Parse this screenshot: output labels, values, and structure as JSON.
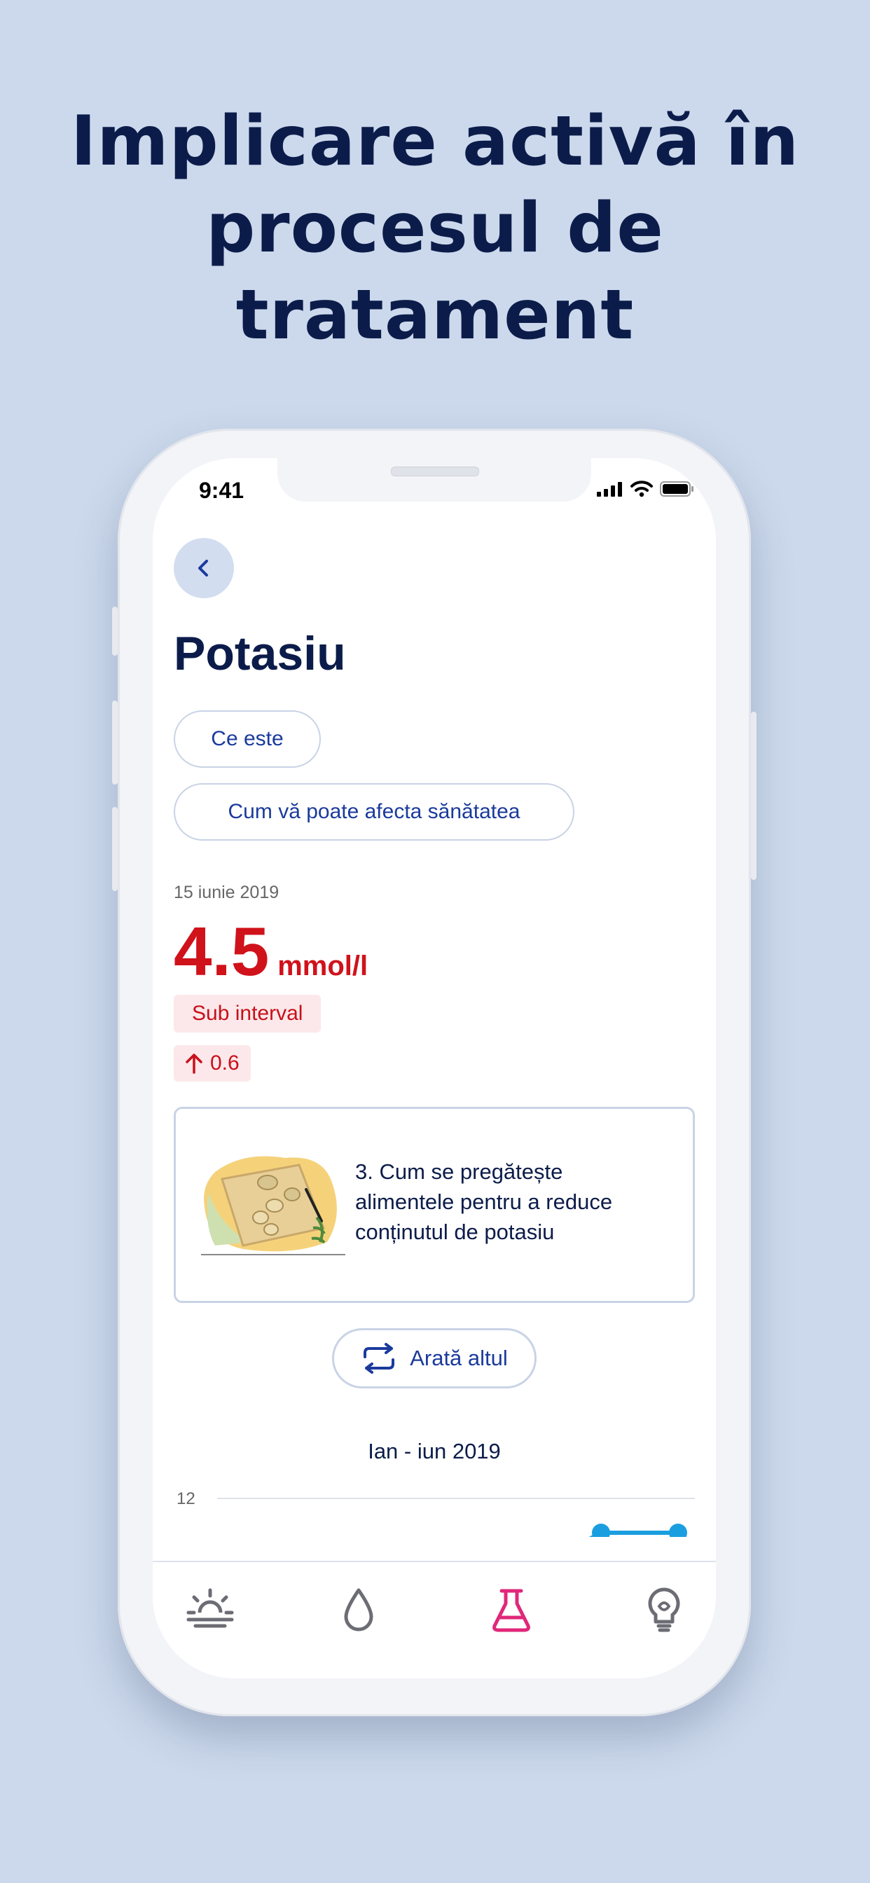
{
  "headline": {
    "line1": "Implicare activă în",
    "line2": "procesul de",
    "line3": "tratament"
  },
  "status_bar": {
    "time": "9:41"
  },
  "page": {
    "title": "Potasiu",
    "back_icon": "chevron-left-icon"
  },
  "info_buttons": [
    {
      "label": "Ce este"
    },
    {
      "label": "Cum vă poate afecta sănătatea"
    }
  ],
  "measurement": {
    "date": "15 iunie 2019",
    "value": "4.5",
    "unit": "mmol/l",
    "status": "Sub interval",
    "change": "0.6",
    "change_icon": "arrow-up-icon",
    "accent_color": "#d0121b"
  },
  "tip_card": {
    "text": "3. Cum se pregătește alimentele pentru a reduce conținutul de potasiu",
    "image": "food-preparation-illustration"
  },
  "show_other": {
    "label": "Arată altul",
    "icon": "refresh-icon"
  },
  "chart_data": {
    "type": "line",
    "title": "Ian - iun 2019",
    "y_ticks": [
      "12"
    ],
    "series_color": "#1a9ee0"
  },
  "tabbar": {
    "items": [
      {
        "icon": "sunrise-icon",
        "active": false
      },
      {
        "icon": "drop-icon",
        "active": false
      },
      {
        "icon": "flask-icon",
        "active": true
      },
      {
        "icon": "lightbulb-icon",
        "active": false
      }
    ],
    "active_color": "#e0287a",
    "inactive_color": "#6c6c74"
  }
}
